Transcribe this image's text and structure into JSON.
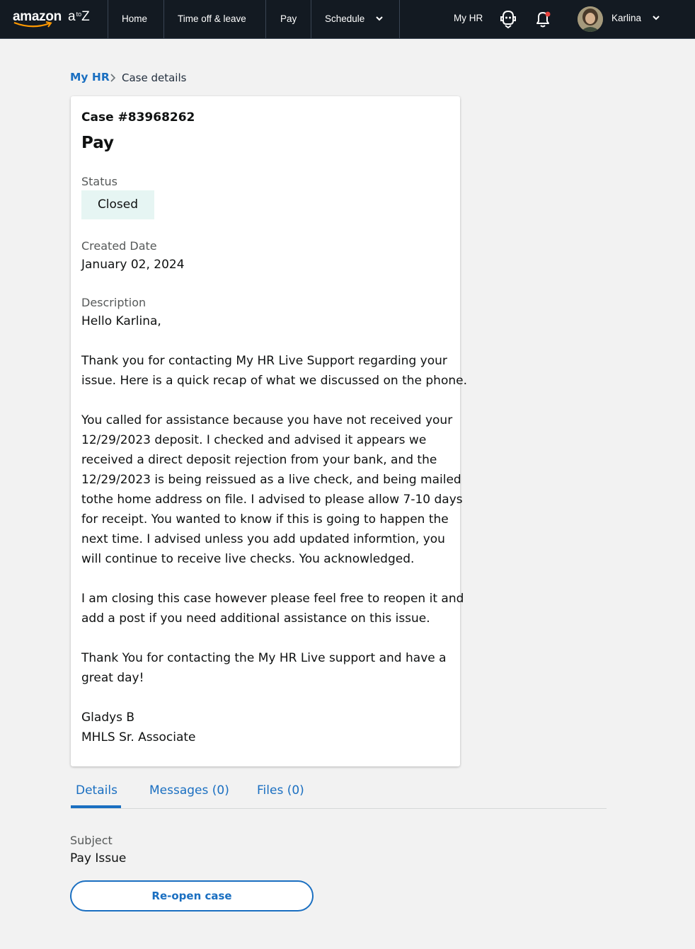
{
  "nav": {
    "logo_word": "amazon",
    "logo_a": "a",
    "logo_toz": "to",
    "logo_z": "Z",
    "items": [
      {
        "label": "Home"
      },
      {
        "label": "Time off & leave"
      },
      {
        "label": "Pay"
      },
      {
        "label": "Schedule"
      }
    ],
    "my_hr": "My HR",
    "user_name": "Karlina",
    "icons": {
      "chat": "chat-bot-icon",
      "bell": "bell-icon",
      "chevron": "chevron-down-icon"
    },
    "notification_dot_color": "#e9453f"
  },
  "breadcrumb": {
    "link": "My HR",
    "current": "Case details"
  },
  "case": {
    "number": "Case #83968262",
    "title": "Pay",
    "status_label": "Status",
    "status_value": "Closed",
    "created_label": "Created Date",
    "created_value": "January 02, 2024",
    "description_label": "Description",
    "description_lines": [
      "Hello Karlina,",
      "",
      "Thank you for contacting My HR Live Support regarding your",
      "issue. Here is a quick recap of what we discussed on the phone.",
      "",
      "You called for assistance because you have not received your",
      "12/29/2023 deposit. I checked and advised it appears we",
      "received a direct deposit rejection from your bank, and the",
      "12/29/2023 is being reissued as a live check, and being mailed",
      "tothe home address on file. I advised to please allow 7-10 days",
      "for receipt. You wanted to know if this is going to happen the",
      "next time. I advised unless you add updated informtion, you",
      "will continue to receive live checks. You acknowledged.",
      "",
      "I am closing this case however please feel free to reopen it and",
      "add a post if you need additional assistance on this issue.",
      "",
      "Thank You for contacting the My HR Live support and have a",
      "great day!",
      "",
      "Gladys B",
      "MHLS Sr. Associate"
    ]
  },
  "tabs": [
    {
      "label": "Details",
      "active": true
    },
    {
      "label": "Messages (0)",
      "active": false
    },
    {
      "label": "Files (0)",
      "active": false
    }
  ],
  "details": {
    "subject_label": "Subject",
    "subject_value": "Pay Issue",
    "reopen_label": "Re-open case"
  },
  "colors": {
    "nav_bg": "#131a22",
    "link_blue": "#1a6fc1",
    "status_bg": "#e6f5f3",
    "page_bg": "#f2f2f2"
  }
}
